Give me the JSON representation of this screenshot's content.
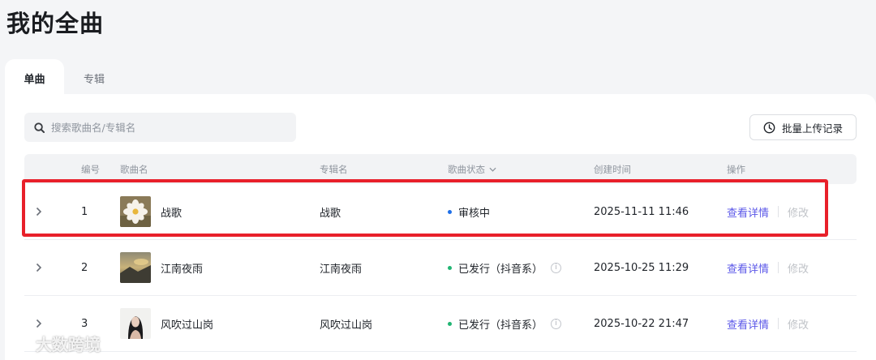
{
  "page": {
    "title": "我的全曲"
  },
  "tabs": [
    {
      "label": "单曲",
      "active": true
    },
    {
      "label": "专辑",
      "active": false
    }
  ],
  "search": {
    "placeholder": "搜索歌曲名/专辑名",
    "icon": "search-icon"
  },
  "batch_button": {
    "label": "批量上传记录",
    "icon": "clock-icon"
  },
  "table": {
    "headers": {
      "number": "编号",
      "song_name": "歌曲名",
      "album_name": "专辑名",
      "status": "歌曲状态",
      "created_time": "创建时间",
      "actions": "操作"
    },
    "rows": [
      {
        "number": "1",
        "song": "战歌",
        "album": "战歌",
        "status": "审核中",
        "status_color": "#1e6fe8",
        "created": "2025-11-11 11:46",
        "detail": "查看详情",
        "edit": "修改",
        "info": false,
        "highlighted": true
      },
      {
        "number": "2",
        "song": "江南夜雨",
        "album": "江南夜雨",
        "status": "已发行（抖音系）",
        "status_color": "#21b573",
        "created": "2025-10-25 11:29",
        "detail": "查看详情",
        "edit": "修改",
        "info": true,
        "highlighted": false
      },
      {
        "number": "3",
        "song": "风吹过山岗",
        "album": "风吹过山岗",
        "status": "已发行（抖音系）",
        "status_color": "#21b573",
        "created": "2025-10-22 21:47",
        "detail": "查看详情",
        "edit": "修改",
        "info": true,
        "highlighted": false
      }
    ]
  },
  "watermark": {
    "text": "大数跨境"
  },
  "colors": {
    "accent": "#5b57e8",
    "highlight": "#e8202a",
    "background": "#f4f5f7"
  }
}
